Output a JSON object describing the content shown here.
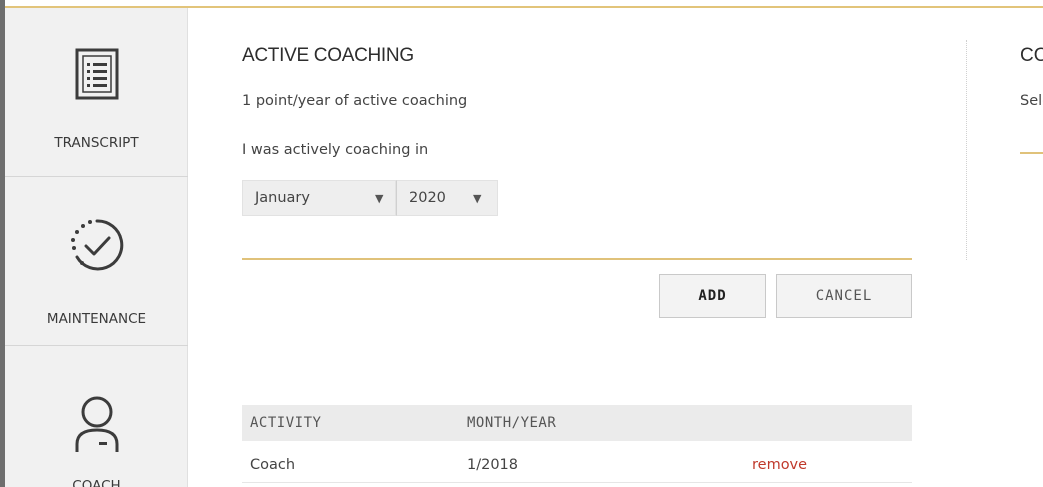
{
  "sidebar": {
    "items": [
      {
        "label": "TRANSCRIPT",
        "icon": "transcript-icon"
      },
      {
        "label": "MAINTENANCE",
        "icon": "check-circle-icon"
      },
      {
        "label": "COACH",
        "icon": "person-icon"
      }
    ]
  },
  "main": {
    "title": "ACTIVE COACHING",
    "subtitle": "1 point/year of active coaching",
    "prompt": "I was actively coaching in",
    "month_select": {
      "value": "January",
      "caret": "▼"
    },
    "year_select": {
      "value": "2020",
      "caret": "▼"
    },
    "buttons": {
      "add": "ADD",
      "cancel": "CANCEL"
    },
    "table": {
      "headers": [
        "ACTIVITY",
        "MONTH/YEAR"
      ],
      "rows": [
        {
          "activity": "Coach",
          "month_year": "1/2018",
          "action": "remove"
        }
      ]
    }
  },
  "right_panel": {
    "title": "CO",
    "subtitle": "Sele"
  },
  "colors": {
    "accent_gold": "#e0c27a",
    "remove_red": "#c0392b",
    "sidebar_bg": "#f1f1f1"
  }
}
